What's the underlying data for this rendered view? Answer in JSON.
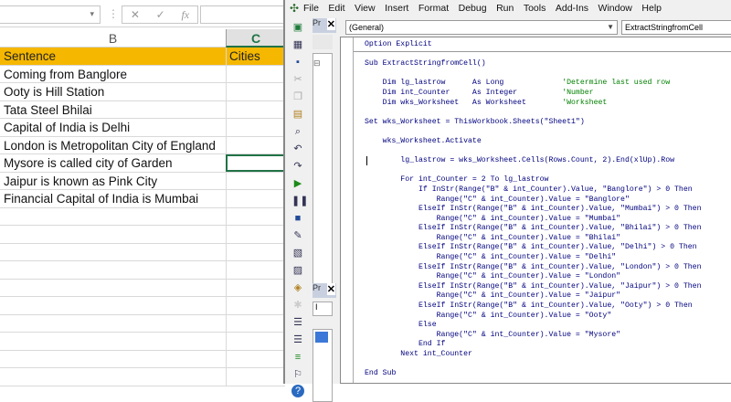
{
  "excel": {
    "formula_bar": {
      "fx": "fx",
      "cancel": "✕",
      "enter": "✓"
    },
    "columns": [
      "B",
      "C"
    ],
    "header": {
      "sentence": "Sentence",
      "cities": "Cities"
    },
    "rows": [
      "Coming from Banglore",
      "Ooty is Hill Station",
      "Tata Steel Bhilai",
      "Capital of India is Delhi",
      "London is Metropolitan City of England",
      "Mysore is called city of Garden",
      "Jaipur is known as Pink City",
      "Financial Capital of India is Mumbai"
    ],
    "colors": {
      "header_fill": "#f5b700",
      "accent": "#217346"
    }
  },
  "vbe": {
    "menu": [
      "File",
      "Edit",
      "View",
      "Insert",
      "Format",
      "Debug",
      "Run",
      "Tools",
      "Add-Ins",
      "Window",
      "Help"
    ],
    "project_title": "Pr",
    "properties_title": "Pr",
    "properties_dropdown": "I",
    "object_dropdown": "(General)",
    "procedure_dropdown": "ExtractStringfromCell",
    "code": [
      {
        "t": "Option Explicit"
      },
      {
        "t": ""
      },
      {
        "t": "Sub ExtractStringfromCell()"
      },
      {
        "t": ""
      },
      {
        "t": "    Dim lg_lastrow      As Long             ",
        "c": "'Determine last used row"
      },
      {
        "t": "    Dim int_Counter     As Integer          ",
        "c": "'Number"
      },
      {
        "t": "    Dim wks_Worksheet   As Worksheet        ",
        "c": "'Worksheet"
      },
      {
        "t": ""
      },
      {
        "t": "Set wks_Worksheet = ThisWorkbook.Sheets(\"Sheet1\")"
      },
      {
        "t": ""
      },
      {
        "t": "    wks_Worksheet.Activate"
      },
      {
        "t": ""
      },
      {
        "t": "        lg_lastrow = wks_Worksheet.Cells(Rows.Count, 2).End(xlUp).Row"
      },
      {
        "t": ""
      },
      {
        "t": "        For int_Counter = 2 To lg_lastrow"
      },
      {
        "t": "            If InStr(Range(\"B\" & int_Counter).Value, \"Banglore\") > 0 Then"
      },
      {
        "t": "                Range(\"C\" & int_Counter).Value = \"Banglore\""
      },
      {
        "t": "            ElseIf InStr(Range(\"B\" & int_Counter).Value, \"Mumbai\") > 0 Then"
      },
      {
        "t": "                Range(\"C\" & int_Counter).Value = \"Mumbai\""
      },
      {
        "t": "            ElseIf InStr(Range(\"B\" & int_Counter).Value, \"Bhilai\") > 0 Then"
      },
      {
        "t": "                Range(\"C\" & int_Counter).Value = \"Bhilai\""
      },
      {
        "t": "            ElseIf InStr(Range(\"B\" & int_Counter).Value, \"Delhi\") > 0 Then"
      },
      {
        "t": "                Range(\"C\" & int_Counter).Value = \"Delhi\""
      },
      {
        "t": "            ElseIf InStr(Range(\"B\" & int_Counter).Value, \"London\") > 0 Then"
      },
      {
        "t": "                Range(\"C\" & int_Counter).Value = \"London\""
      },
      {
        "t": "            ElseIf InStr(Range(\"B\" & int_Counter).Value, \"Jaipur\") > 0 Then"
      },
      {
        "t": "                Range(\"C\" & int_Counter).Value = \"Jaipur\""
      },
      {
        "t": "            ElseIf InStr(Range(\"B\" & int_Counter).Value, \"Ooty\") > 0 Then"
      },
      {
        "t": "                Range(\"C\" & int_Counter).Value = \"Ooty\""
      },
      {
        "t": "            Else"
      },
      {
        "t": "                Range(\"C\" & int_Counter).Value = \"Mysore\""
      },
      {
        "t": "            End If"
      },
      {
        "t": "        Next int_Counter"
      },
      {
        "t": ""
      },
      {
        "t": "End Sub"
      }
    ]
  }
}
